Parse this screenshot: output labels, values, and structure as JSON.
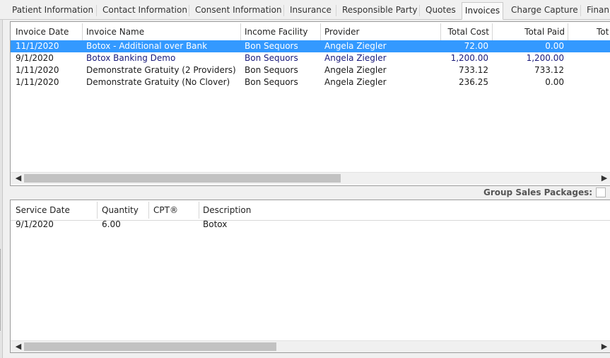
{
  "tabs": [
    {
      "label": "Patient Information"
    },
    {
      "label": "Contact Information"
    },
    {
      "label": "Consent Information"
    },
    {
      "label": "Insurance"
    },
    {
      "label": "Responsible Party"
    },
    {
      "label": "Quotes"
    },
    {
      "label": "Invoices",
      "active": true
    },
    {
      "label": "Charge Capture"
    },
    {
      "label": "Finan"
    }
  ],
  "invoices": {
    "columns": [
      "Invoice Date",
      "Invoice Name",
      "Income Facility",
      "Provider",
      "Total Cost",
      "Total Paid",
      "Tot"
    ],
    "rows": [
      {
        "date": "11/1/2020",
        "name": "Botox - Additional over Bank",
        "facility": "Bon Sequors",
        "provider": "Angela Ziegler",
        "total_cost": "72.00",
        "total_paid": "0.00",
        "selected": true
      },
      {
        "date": "9/1/2020",
        "name": "Botox Banking Demo",
        "facility": "Bon Sequors",
        "provider": "Angela Ziegler",
        "total_cost": "1,200.00",
        "total_paid": "1,200.00"
      },
      {
        "date": "1/11/2020",
        "name": "Demonstrate Gratuity (2 Providers)",
        "facility": "Bon Sequors",
        "provider": "Angela Ziegler",
        "total_cost": "733.12",
        "total_paid": "733.12"
      },
      {
        "date": "1/11/2020",
        "name": "Demonstrate Gratuity (No Clover)",
        "facility": "Bon Sequors",
        "provider": "Angela Ziegler",
        "total_cost": "236.25",
        "total_paid": "0.00"
      }
    ]
  },
  "group_sales": {
    "label": "Group Sales Packages:",
    "checked": false
  },
  "services": {
    "columns": [
      "Service Date",
      "Quantity",
      "CPT®",
      "Description"
    ],
    "rows": [
      {
        "date": "9/1/2020",
        "quantity": "6.00",
        "cpt": "",
        "description": "Botox"
      }
    ]
  },
  "icons": {
    "scroll_left": "◀",
    "scroll_right": "▶"
  }
}
